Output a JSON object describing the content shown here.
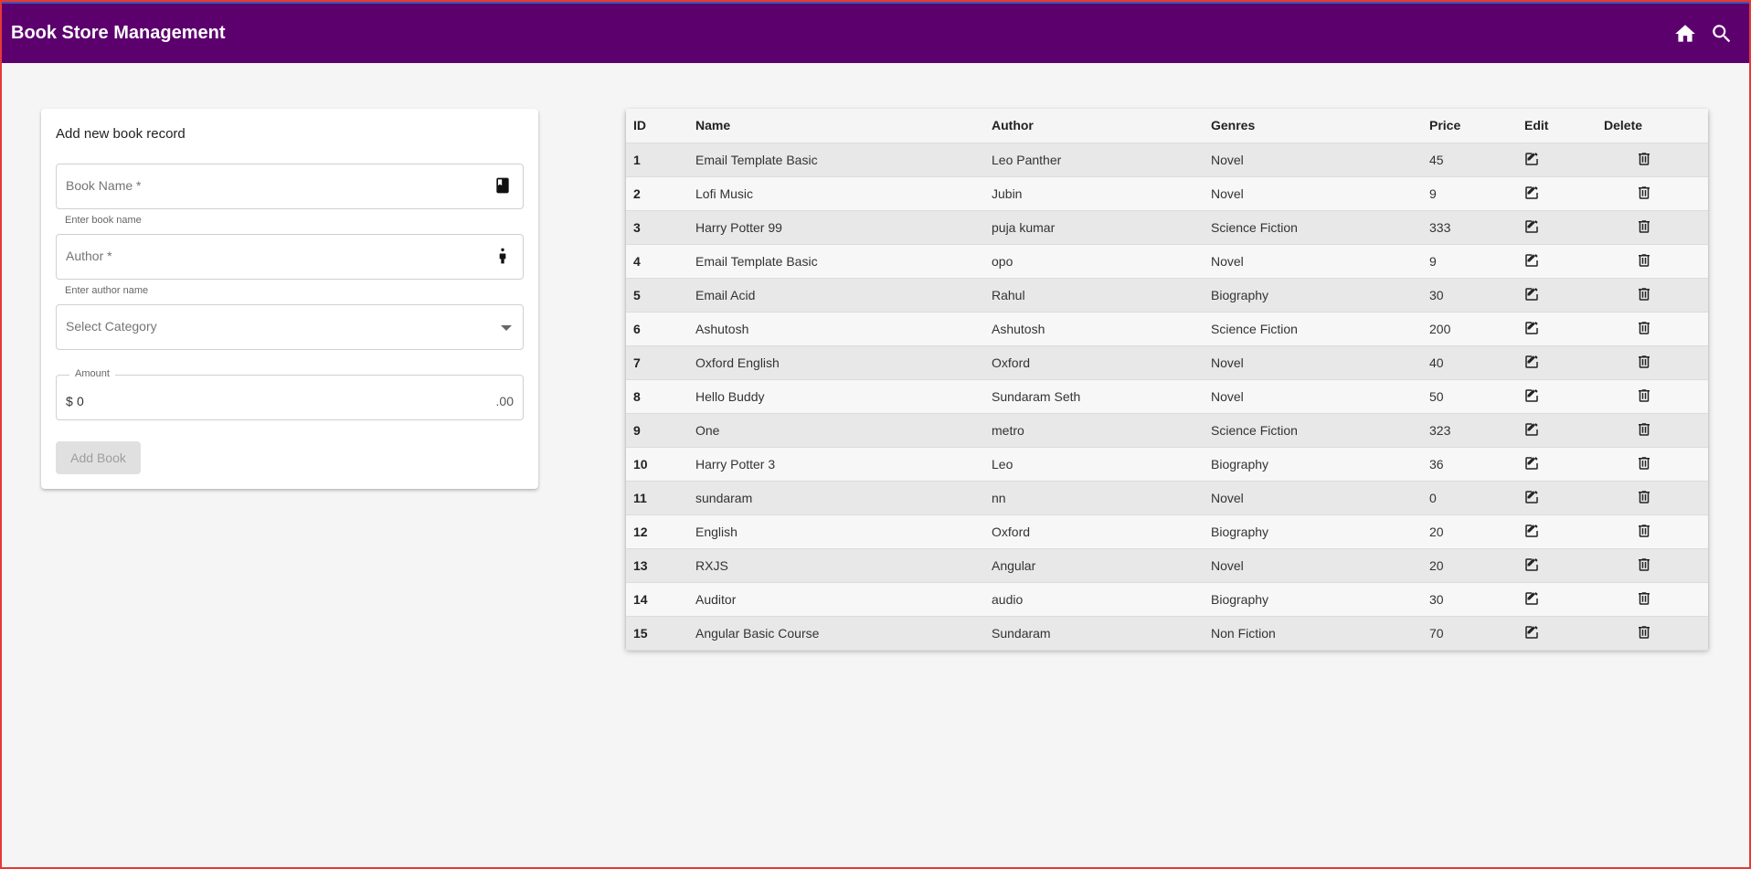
{
  "header": {
    "title": "Book Store Management",
    "icons": [
      "home-icon",
      "search-icon"
    ]
  },
  "form": {
    "title": "Add new book record",
    "book_name_placeholder": "Book Name *",
    "book_name_hint": "Enter book name",
    "book_name_icon": "book-icon",
    "author_placeholder": "Author *",
    "author_hint": "Enter author name",
    "author_icon": "person-icon",
    "category_placeholder": "Select Category",
    "amount_label": "Amount",
    "amount_prefix": "$",
    "amount_value": "0",
    "amount_suffix": ".00",
    "submit_label": "Add Book"
  },
  "table": {
    "columns": [
      "ID",
      "Name",
      "Author",
      "Genres",
      "Price",
      "Edit",
      "Delete"
    ],
    "edit_icon": "edit-icon",
    "delete_icon": "delete-icon",
    "rows": [
      {
        "id": "1",
        "name": "Email Template Basic",
        "author": "Leo Panther",
        "genre": "Novel",
        "price": "45"
      },
      {
        "id": "2",
        "name": "Lofi Music",
        "author": "Jubin",
        "genre": "Novel",
        "price": "9"
      },
      {
        "id": "3",
        "name": "Harry Potter 99",
        "author": "puja kumar",
        "genre": "Science Fiction",
        "price": "333"
      },
      {
        "id": "4",
        "name": "Email Template Basic",
        "author": "opo",
        "genre": "Novel",
        "price": "9"
      },
      {
        "id": "5",
        "name": "Email Acid",
        "author": "Rahul",
        "genre": "Biography",
        "price": "30"
      },
      {
        "id": "6",
        "name": "Ashutosh",
        "author": "Ashutosh",
        "genre": "Science Fiction",
        "price": "200"
      },
      {
        "id": "7",
        "name": "Oxford English",
        "author": "Oxford",
        "genre": "Novel",
        "price": "40"
      },
      {
        "id": "8",
        "name": "Hello Buddy",
        "author": "Sundaram Seth",
        "genre": "Novel",
        "price": "50"
      },
      {
        "id": "9",
        "name": "One",
        "author": "metro",
        "genre": "Science Fiction",
        "price": "323"
      },
      {
        "id": "10",
        "name": "Harry Potter 3",
        "author": "Leo",
        "genre": "Biography",
        "price": "36"
      },
      {
        "id": "11",
        "name": "sundaram",
        "author": "nn",
        "genre": "Novel",
        "price": "0"
      },
      {
        "id": "12",
        "name": "English",
        "author": "Oxford",
        "genre": "Biography",
        "price": "20"
      },
      {
        "id": "13",
        "name": "RXJS",
        "author": "Angular",
        "genre": "Novel",
        "price": "20"
      },
      {
        "id": "14",
        "name": "Auditor",
        "author": "audio",
        "genre": "Biography",
        "price": "30"
      },
      {
        "id": "15",
        "name": "Angular Basic Course",
        "author": "Sundaram",
        "genre": "Non Fiction",
        "price": "70"
      }
    ]
  },
  "colors": {
    "toolbar": "#5c006e",
    "page_background": "#f5f5f5",
    "window_border": "#e53935"
  }
}
